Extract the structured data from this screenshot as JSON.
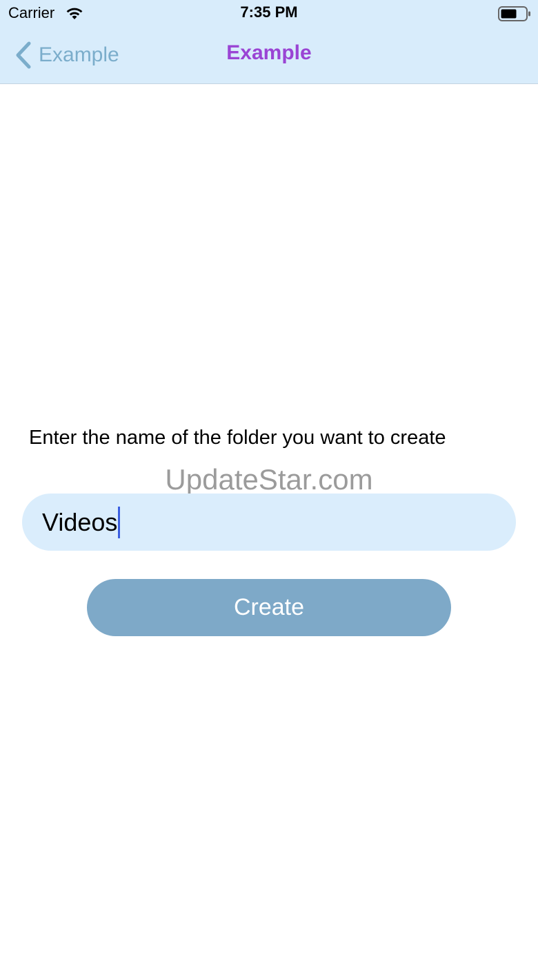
{
  "status_bar": {
    "carrier": "Carrier",
    "time": "7:35 PM",
    "wifi_icon": "wifi-icon",
    "battery_icon": "battery-icon"
  },
  "nav": {
    "back_label": "Example",
    "back_icon": "chevron-left-icon",
    "title": "Example"
  },
  "form": {
    "prompt": "Enter the name of the folder you want to create",
    "folder_name_value": "Videos",
    "create_label": "Create"
  },
  "watermark": "UpdateStar.com",
  "colors": {
    "nav_background": "#d8ecfb",
    "title": "#9a44d4",
    "back": "#7badcb",
    "field_background": "#daedfc",
    "button_background": "#7ea9c8",
    "cursor": "#3b5fe0"
  }
}
